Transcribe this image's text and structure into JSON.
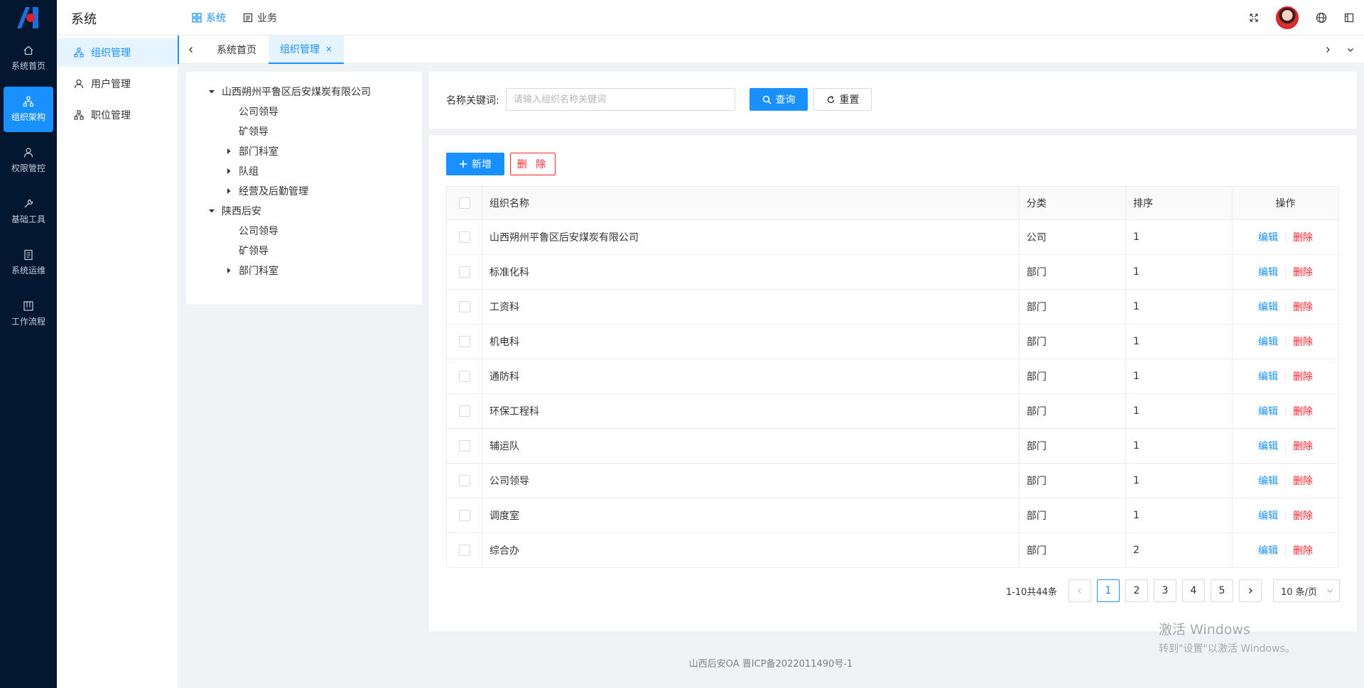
{
  "app": {
    "title": "系统"
  },
  "rail": {
    "items": [
      {
        "label": "系统首页",
        "icon": "home-icon"
      },
      {
        "label": "组织架构",
        "icon": "org-tree-icon",
        "active": true
      },
      {
        "label": "权限管控",
        "icon": "user-icon"
      },
      {
        "label": "基础工具",
        "icon": "wrench-icon"
      },
      {
        "label": "系统运维",
        "icon": "doc-icon"
      },
      {
        "label": "工作流程",
        "icon": "flow-icon"
      }
    ]
  },
  "top_nav": {
    "system_label": "系统",
    "business_label": "业务"
  },
  "sidebar": {
    "items": [
      {
        "label": "组织管理",
        "active": true
      },
      {
        "label": "用户管理"
      },
      {
        "label": "职位管理"
      }
    ]
  },
  "tabs": {
    "items": [
      {
        "label": "系统首页"
      },
      {
        "label": "组织管理",
        "active": true,
        "close": "×"
      }
    ]
  },
  "tree": {
    "nodes": [
      {
        "label": "山西朔州平鲁区后安煤炭有限公司",
        "caret": "expanded"
      },
      {
        "label": "公司领导"
      },
      {
        "label": "矿领导"
      },
      {
        "label": "部门科室",
        "caret": "collapsed"
      },
      {
        "label": "队组",
        "caret": "collapsed"
      },
      {
        "label": "经营及后勤管理",
        "caret": "collapsed"
      },
      {
        "label": "陕西后安",
        "caret": "expanded"
      },
      {
        "label": "公司领导"
      },
      {
        "label": "矿领导"
      },
      {
        "label": "部门科室",
        "caret": "collapsed"
      }
    ]
  },
  "search": {
    "label": "名称关键词:",
    "placeholder": "请输入组织名称关键词",
    "value": "",
    "query_label": "查询",
    "reset_label": "重置"
  },
  "actions": {
    "add_label": "新增",
    "delete_label": "删 除"
  },
  "table": {
    "columns": [
      "组织名称",
      "分类",
      "排序",
      "操作"
    ],
    "edit_label": "编辑",
    "delete_label": "删除",
    "rows": [
      {
        "name": "山西朔州平鲁区后安煤炭有限公司",
        "category": "公司",
        "order": "1"
      },
      {
        "name": "标准化科",
        "category": "部门",
        "order": "1"
      },
      {
        "name": "工资科",
        "category": "部门",
        "order": "1"
      },
      {
        "name": "机电科",
        "category": "部门",
        "order": "1"
      },
      {
        "name": "通防科",
        "category": "部门",
        "order": "1"
      },
      {
        "name": "环保工程科",
        "category": "部门",
        "order": "1"
      },
      {
        "name": "辅运队",
        "category": "部门",
        "order": "1"
      },
      {
        "name": "公司领导",
        "category": "部门",
        "order": "1"
      },
      {
        "name": "调度室",
        "category": "部门",
        "order": "1"
      },
      {
        "name": "综合办",
        "category": "部门",
        "order": "2"
      }
    ]
  },
  "pagination": {
    "total_text": "1-10共44条",
    "pages": [
      "1",
      "2",
      "3",
      "4",
      "5"
    ],
    "current": "1",
    "page_size": "10 条/页"
  },
  "footer": {
    "text": "山西后安OA 晋ICP备2022011490号-1"
  },
  "watermark": {
    "line1": "激活 Windows",
    "line2": "转到\"设置\"以激活 Windows。"
  },
  "colors": {
    "primary": "#1890ff",
    "danger": "#f5222d",
    "rail_bg": "#031731"
  }
}
